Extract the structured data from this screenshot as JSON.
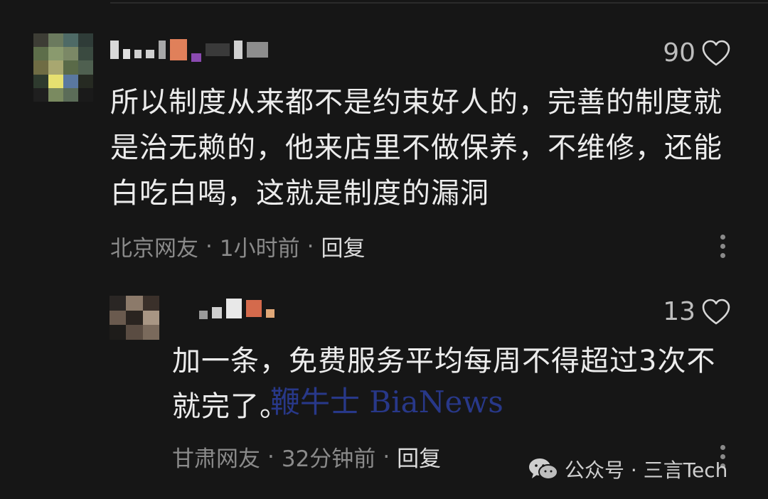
{
  "comments": [
    {
      "likes": "90",
      "text": "所以制度从来都不是约束好人的，完善的制度就是治无赖的，他来店里不做保养，不维修，还能白吃白喝，这就是制度的漏洞",
      "location": "北京网友",
      "separator": "·",
      "time": "1小时前",
      "reply_label": "回复"
    },
    {
      "likes": "13",
      "text": "加一条，免费服务平均每周不得超过3次不就完了。",
      "location": "甘肃网友",
      "separator": "·",
      "time": "32分钟前",
      "reply_label": "回复"
    }
  ],
  "watermark": "鞭牛士 BiaNews",
  "source_label": "公众号 · 三言Tech",
  "icons": [
    "heart-icon",
    "more-vertical-icon",
    "wechat-icon"
  ],
  "colors": {
    "background": "#161616",
    "text": "#ececec",
    "meta": "#8a8a8a",
    "watermark": "#2c3f9e"
  }
}
